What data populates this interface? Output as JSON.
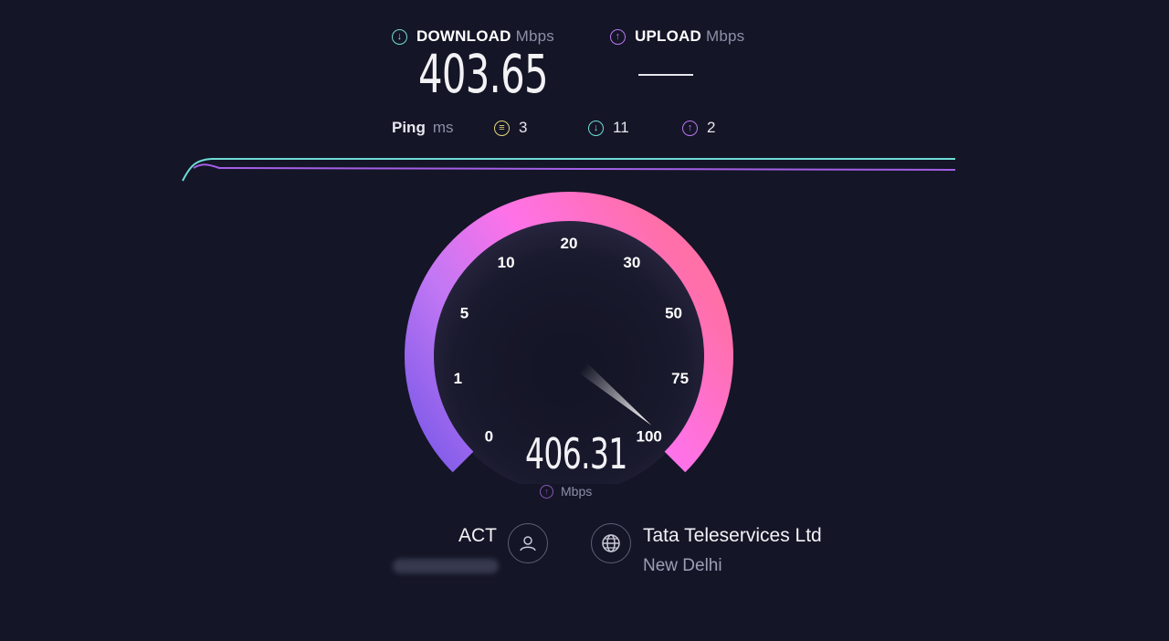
{
  "download": {
    "label": "DOWNLOAD",
    "unit": "Mbps",
    "value": "403.65",
    "icon": "arrow-down-circle-icon"
  },
  "upload": {
    "label": "UPLOAD",
    "unit": "Mbps",
    "value_placeholder": "—",
    "icon": "arrow-up-circle-icon"
  },
  "ping": {
    "label": "Ping",
    "unit": "ms",
    "idle": {
      "value": "3",
      "icon": "idle-latency-icon"
    },
    "download": {
      "value": "11",
      "icon": "arrow-down-circle-icon"
    },
    "upload": {
      "value": "2",
      "icon": "arrow-up-circle-icon"
    }
  },
  "gauge": {
    "value": "406.31",
    "unit": "Mbps",
    "reading": 406.31,
    "ticks": [
      "0",
      "1",
      "5",
      "10",
      "20",
      "30",
      "50",
      "75",
      "100"
    ]
  },
  "isp": {
    "name": "ACT",
    "icon": "user-icon"
  },
  "server": {
    "name": "Tata Teleservices Ltd",
    "location": "New Delhi",
    "icon": "globe-icon"
  },
  "colors": {
    "cyan": "#6fdcd6",
    "purple": "#b977f0",
    "gauge_start": "#7a59e8",
    "gauge_mid": "#ff72e8",
    "gauge_end": "#ff6fa8"
  }
}
